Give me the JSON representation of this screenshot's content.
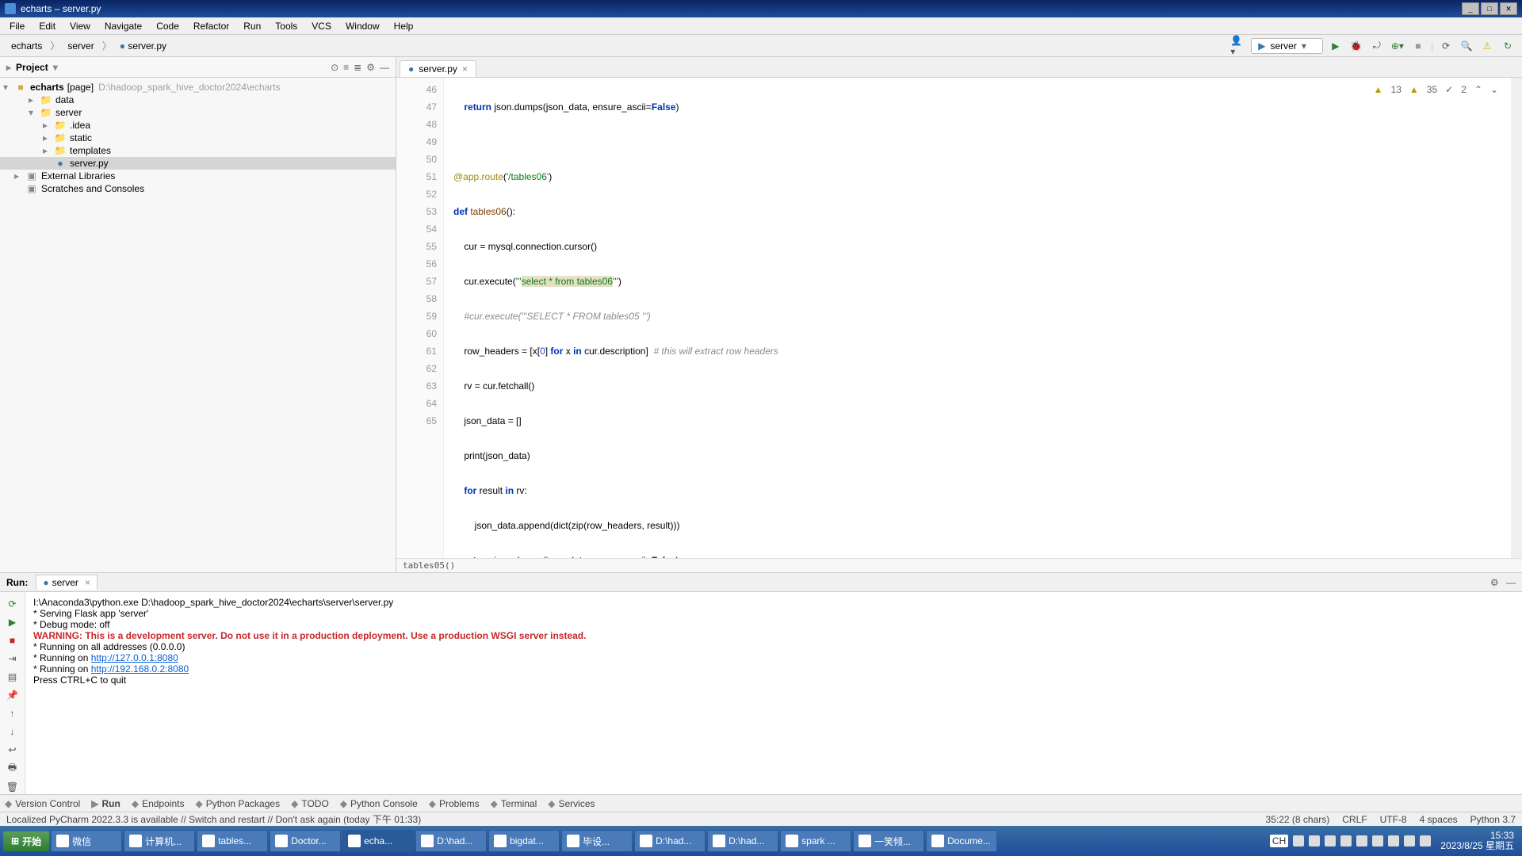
{
  "title": "echarts – server.py",
  "menu": [
    "File",
    "Edit",
    "View",
    "Navigate",
    "Code",
    "Refactor",
    "Run",
    "Tools",
    "VCS",
    "Window",
    "Help"
  ],
  "breadcrumbs": [
    "echarts",
    "server",
    "server.py"
  ],
  "run_config": "server",
  "project": {
    "title": "Project",
    "root": {
      "name": "echarts",
      "tag": "[page]",
      "path": "D:\\hadoop_spark_hive_doctor2024\\echarts"
    },
    "tree": [
      {
        "indent": 1,
        "name": "data",
        "type": "folder",
        "arrow": "▸"
      },
      {
        "indent": 1,
        "name": "server",
        "type": "folder",
        "arrow": "▾"
      },
      {
        "indent": 2,
        "name": ".idea",
        "type": "folder",
        "arrow": "▸"
      },
      {
        "indent": 2,
        "name": "static",
        "type": "folder",
        "arrow": "▸"
      },
      {
        "indent": 2,
        "name": "templates",
        "type": "folder",
        "arrow": "▸"
      },
      {
        "indent": 2,
        "name": "server.py",
        "type": "pyfile",
        "selected": true
      },
      {
        "indent": 0,
        "name": "External Libraries",
        "type": "lib",
        "arrow": "▸"
      },
      {
        "indent": 0,
        "name": "Scratches and Consoles",
        "type": "lib",
        "arrow": ""
      }
    ]
  },
  "tab": {
    "name": "server.py"
  },
  "inspections": {
    "warnings": "13",
    "weak": "35",
    "typos": "2"
  },
  "gutter_start": 46,
  "gutter_count": 20,
  "breadcrumb_bottom": "tables05()",
  "console": {
    "title": "Run:",
    "tab": "server",
    "lines": [
      {
        "t": "I:\\Anaconda3\\python.exe D:\\hadoop_spark_hive_doctor2024\\echarts\\server\\server.py"
      },
      {
        "t": " * Serving Flask app 'server'"
      },
      {
        "t": " * Debug mode: off"
      },
      {
        "t": "WARNING: This is a development server. Do not use it in a production deployment. Use a production WSGI server instead.",
        "cls": "red"
      },
      {
        "t": " * Running on all addresses (0.0.0.0)"
      },
      {
        "prefix": " * Running on ",
        "link": "http://127.0.0.1:8080"
      },
      {
        "prefix": " * Running on ",
        "link": "http://192.168.0.2:8080"
      },
      {
        "t": "Press CTRL+C to quit"
      }
    ]
  },
  "tool_buttons": [
    "Version Control",
    "Run",
    "Endpoints",
    "Python Packages",
    "TODO",
    "Python Console",
    "Problems",
    "Terminal",
    "Services"
  ],
  "status_left": "Localized PyCharm 2022.3.3 is available // Switch and restart // Don't ask again (today 下午 01:33)",
  "status_right": [
    "35:22 (8 chars)",
    "CRLF",
    "UTF-8",
    "4 spaces",
    "Python 3.7"
  ],
  "taskbar": {
    "start": "开始",
    "items": [
      {
        "label": "微信"
      },
      {
        "label": "计算机..."
      },
      {
        "label": "tables..."
      },
      {
        "label": "Doctor..."
      },
      {
        "label": "echa...",
        "active": true
      },
      {
        "label": "D:\\had..."
      },
      {
        "label": "bigdat..."
      },
      {
        "label": "毕设..."
      },
      {
        "label": "D:\\had..."
      },
      {
        "label": "D:\\had..."
      },
      {
        "label": "spark ..."
      },
      {
        "label": "一笑倾..."
      },
      {
        "label": "Docume..."
      }
    ],
    "ime": "CH",
    "clock_time": "15:33",
    "clock_date": "2023/8/25 星期五"
  }
}
